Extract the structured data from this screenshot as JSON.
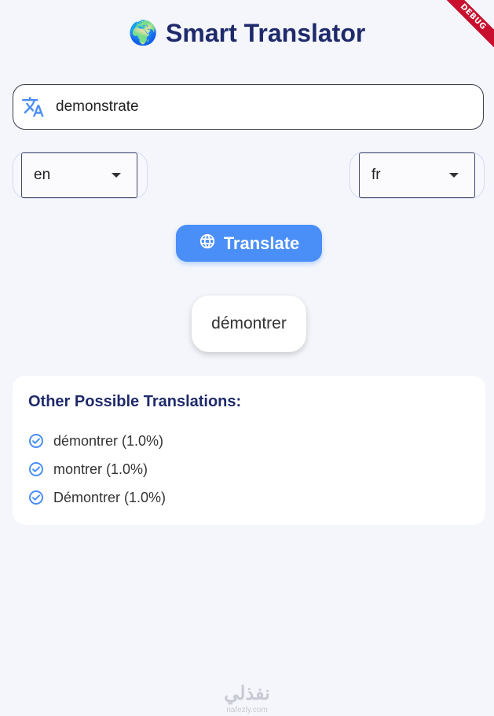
{
  "header": {
    "emoji": "🌍",
    "title": "Smart Translator"
  },
  "debug_banner": "DEBUG",
  "input": {
    "value": "demonstrate",
    "icon": "translate-icon"
  },
  "source_language": {
    "selected": "en"
  },
  "target_language": {
    "selected": "fr"
  },
  "translate_button": {
    "label": "Translate",
    "icon": "language-globe-icon"
  },
  "result": {
    "text": "démontrer"
  },
  "alternatives": {
    "heading": "Other Possible Translations:",
    "items": [
      {
        "text": "démontrer (1.0%)"
      },
      {
        "text": "montrer (1.0%)"
      },
      {
        "text": "Démontrer (1.0%)"
      }
    ]
  },
  "watermark": {
    "text": "نفذلي",
    "sub": "nafezly.com"
  },
  "colors": {
    "accent": "#4a8ef7",
    "title": "#1f2a6b",
    "background": "#f4f6fb",
    "debug": "#c8102e"
  }
}
